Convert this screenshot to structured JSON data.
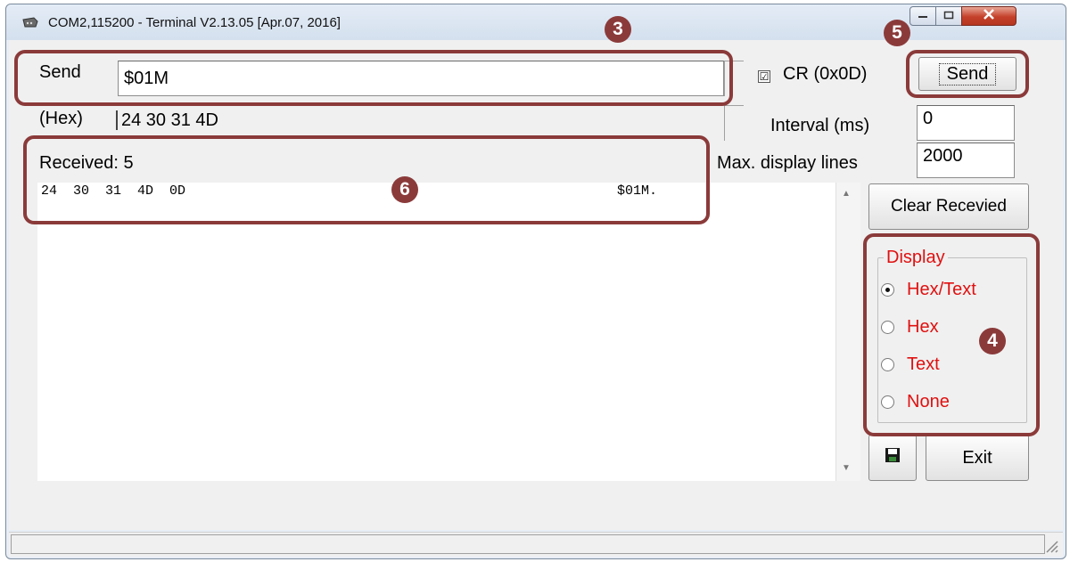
{
  "window": {
    "title": "COM2,115200 - Terminal V2.13.05 [Apr.07, 2016]"
  },
  "send": {
    "label": "Send",
    "value": "$01M",
    "hex_label": "(Hex)",
    "hex_value": "24 30 31 4D"
  },
  "options": {
    "cr_checked": true,
    "cr_mark": "☑",
    "cr_label": "CR (0x0D)",
    "send_button_label": "Send",
    "interval_label": "Interval (ms)",
    "interval_value": "0",
    "max_lines_label": "Max. display lines",
    "max_lines_value": "2000"
  },
  "received": {
    "label": "Received: 5",
    "hex_line": "24  30  31  4D  0D",
    "text_line": "$01M."
  },
  "buttons": {
    "clear_received": "Clear Recevied",
    "exit": "Exit"
  },
  "display": {
    "legend": "Display",
    "selected": "Hex/Text",
    "options": [
      "Hex/Text",
      "Hex",
      "Text",
      "None"
    ]
  },
  "annotations": {
    "badge_3": "3",
    "badge_4": "4",
    "badge_5": "5",
    "badge_6": "6"
  },
  "colors": {
    "annotation": "#8b3a3a",
    "display_text": "#e01010"
  },
  "icons": {
    "app": "serial-port-icon",
    "save": "floppy-disk-icon",
    "minimize": "minimize-icon",
    "maximize": "maximize-icon",
    "close": "close-icon"
  }
}
